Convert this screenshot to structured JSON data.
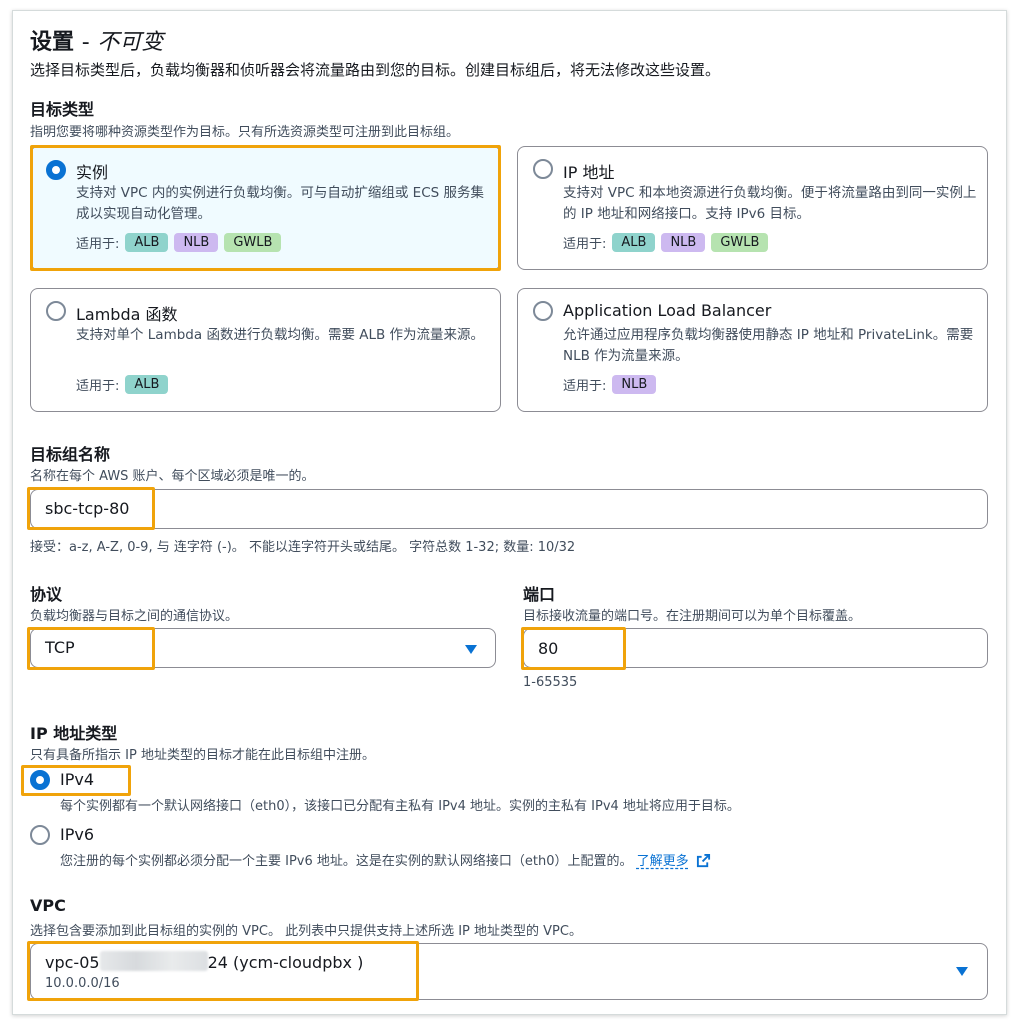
{
  "header": {
    "title": "设置",
    "title_sep": "-",
    "title_sub": "不可变",
    "description": "选择目标类型后，负载均衡器和侦听器会将流量路由到您的目标。创建目标组后，将无法修改这些设置。"
  },
  "target_type": {
    "label": "目标类型",
    "hint": "指明您要将哪种资源类型作为目标。只有所选资源类型可注册到此目标组。",
    "applies_label": "适用于:",
    "options": [
      {
        "title": "实例",
        "desc": "支持对 VPC 内的实例进行负载均衡。可与自动扩缩组或 ECS 服务集成以实现自动化管理。",
        "badges": [
          "ALB",
          "NLB",
          "GWLB"
        ],
        "selected": true
      },
      {
        "title": "IP 地址",
        "desc": "支持对 VPC 和本地资源进行负载均衡。便于将流量路由到同一实例上的 IP 地址和网络接口。支持 IPv6 目标。",
        "badges": [
          "ALB",
          "NLB",
          "GWLB"
        ],
        "selected": false
      },
      {
        "title": "Lambda 函数",
        "desc": "支持对单个 Lambda 函数进行负载均衡。需要 ALB 作为流量来源。",
        "badges": [
          "ALB"
        ],
        "selected": false
      },
      {
        "title": "Application Load Balancer",
        "desc": "允许通过应用程序负载均衡器使用静态 IP 地址和 PrivateLink。需要 NLB 作为流量来源。",
        "badges": [
          "NLB"
        ],
        "selected": false
      }
    ]
  },
  "target_group_name": {
    "label": "目标组名称",
    "hint": "名称在每个 AWS 账户、每个区域必须是唯一的。",
    "value": "sbc-tcp-80",
    "constraint": "接受：a-z, A-Z, 0-9, 与 连字符 (-)。 不能以连字符开头或结尾。 字符总数 1-32; 数量: 10/32"
  },
  "protocol": {
    "label": "协议",
    "hint": "负载均衡器与目标之间的通信协议。",
    "value": "TCP"
  },
  "port": {
    "label": "端口",
    "hint": "目标接收流量的端口号。在注册期间可以为单个目标覆盖。",
    "value": "80",
    "range": "1-65535"
  },
  "ip_type": {
    "label": "IP 地址类型",
    "hint": "只有具备所指示 IP 地址类型的目标才能在此目标组中注册。",
    "options": [
      {
        "title": "IPv4",
        "desc": "每个实例都有一个默认网络接口（eth0），该接口已分配有主私有 IPv4 地址。实例的主私有 IPv4 地址将应用于目标。",
        "selected": true
      },
      {
        "title": "IPv6",
        "desc": "您注册的每个实例都必须分配一个主要 IPv6 地址。这是在实例的默认网络接口（eth0）上配置的。",
        "selected": false
      }
    ],
    "learn_more": "了解更多"
  },
  "vpc": {
    "label": "VPC",
    "hint": "选择包含要添加到此目标组的实例的 VPC。 此列表中只提供支持上述所选 IP 地址类型的 VPC。",
    "value_prefix": "vpc-05",
    "value_suffix": "24 (ycm-cloudpbx )",
    "cidr": "10.0.0.0/16"
  },
  "colors": {
    "accent": "#0972d3",
    "highlight": "#f0a30a",
    "badge_alb": "#8fd3cc",
    "badge_nlb": "#cdb9f0",
    "badge_gwlb": "#b6e3b0",
    "selected_bg": "#f0fbff"
  }
}
